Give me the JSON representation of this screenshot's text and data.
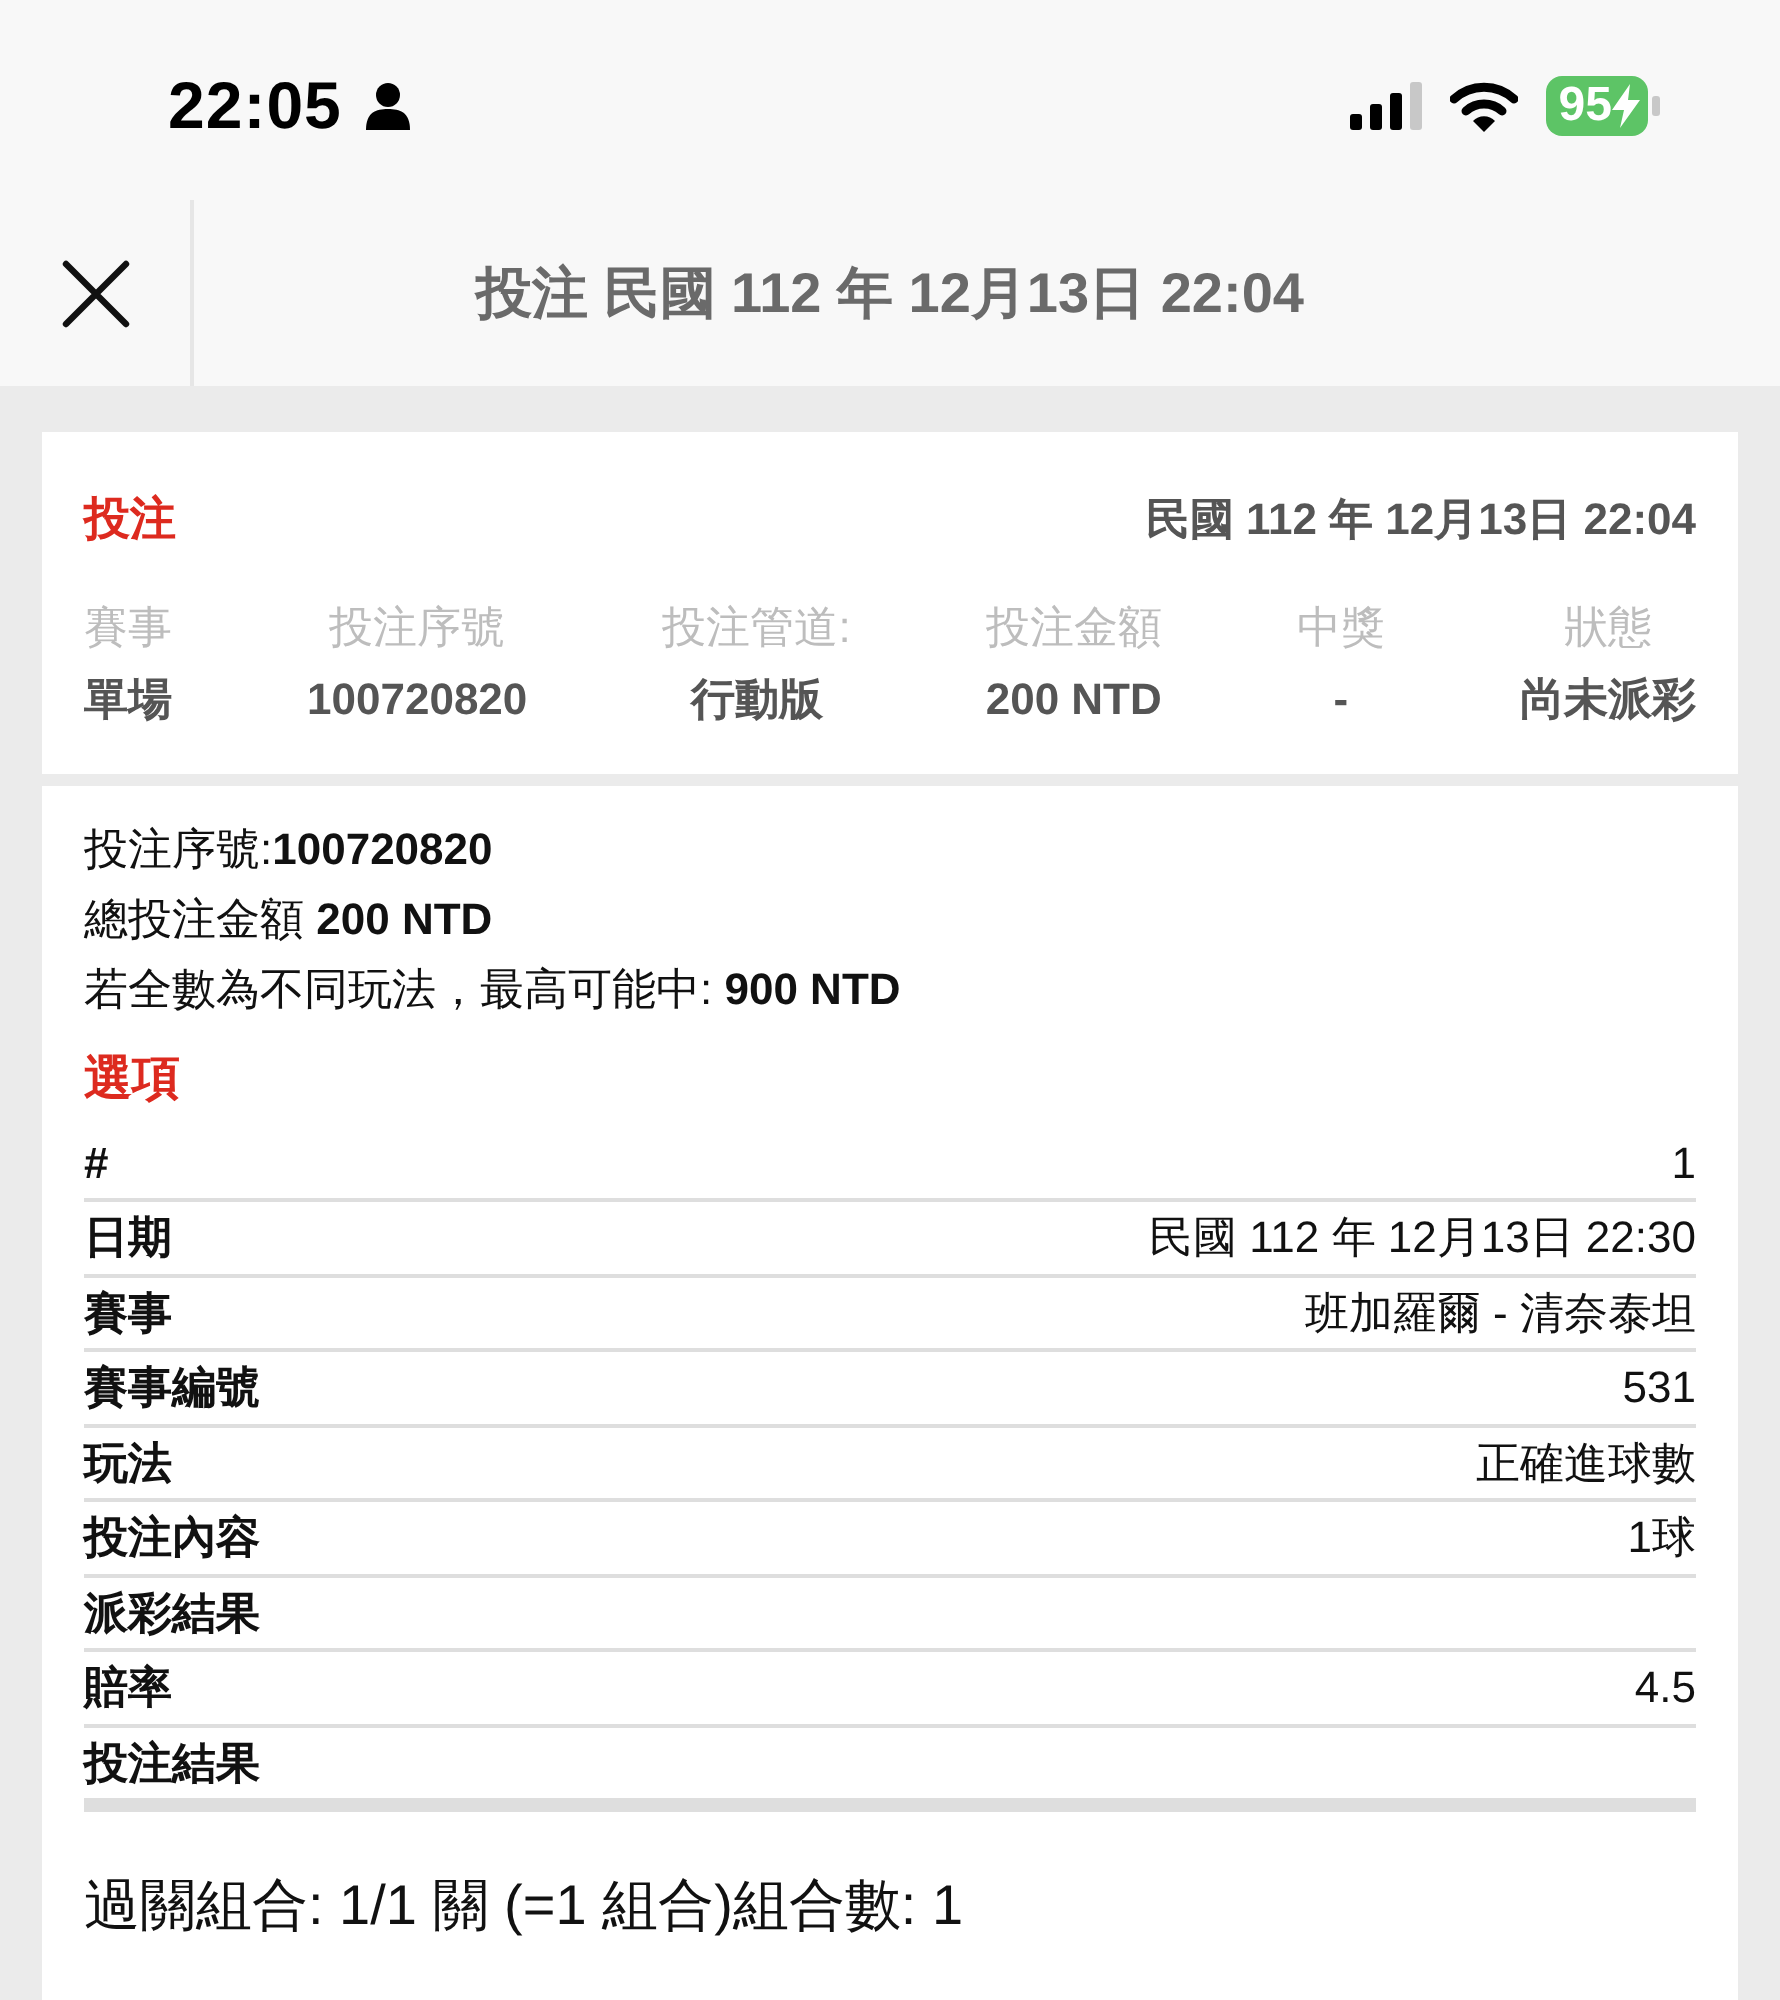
{
  "status_bar": {
    "time": "22:05",
    "battery": "95"
  },
  "header": {
    "title": "投注 民國 112 年 12月13日 22:04"
  },
  "summary": {
    "title": "投注",
    "date": "民國 112 年 12月13日 22:04",
    "columns": [
      {
        "label": "賽事",
        "value": "單場"
      },
      {
        "label": "投注序號",
        "value": "100720820"
      },
      {
        "label": "投注管道:",
        "value": "行動版"
      },
      {
        "label": "投注金額",
        "value": "200 NTD"
      },
      {
        "label": "中獎",
        "value": "-"
      },
      {
        "label": "狀態",
        "value": "尚未派彩"
      }
    ]
  },
  "details": {
    "lines": [
      "投注序號:**100720820**",
      "總投注金額 **200 NTD**",
      "若全數為不同玩法，最高可能中: **900 NTD**"
    ],
    "section_title": "選項",
    "rows": [
      {
        "label": "#",
        "value": "1"
      },
      {
        "label": "日期",
        "value": "民國 112 年 12月13日 22:30"
      },
      {
        "label": "賽事",
        "value": "班加羅爾 - 清奈泰坦"
      },
      {
        "label": "賽事編號",
        "value": "531"
      },
      {
        "label": "玩法",
        "value": "正確進球數"
      },
      {
        "label": "投注內容",
        "value": "1球"
      },
      {
        "label": "派彩結果"
      },
      {
        "label": "賠率",
        "value": "4.5"
      },
      {
        "label": "投注結果"
      }
    ],
    "footer": "過關組合: 1/1 關 (=1 組合)組合數: 1"
  }
}
